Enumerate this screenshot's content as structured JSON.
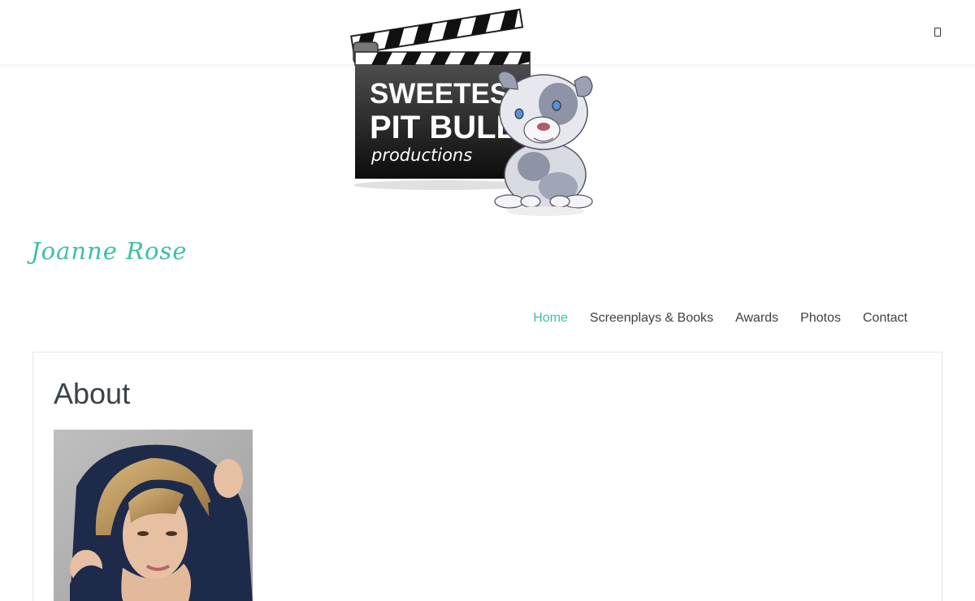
{
  "header": {
    "menu_icon": "menu-toggle-icon",
    "logo": {
      "line1": "SWEETEST",
      "line2": "PIT BULL",
      "line3": "productions"
    }
  },
  "site": {
    "title": "Joanne Rose",
    "accent_color": "#3cc0a4",
    "text_color": "#3b4248"
  },
  "nav": {
    "items": [
      {
        "label": "Home"
      },
      {
        "label": "Screenplays & Books"
      },
      {
        "label": "Awards"
      },
      {
        "label": "Photos"
      },
      {
        "label": "Contact"
      }
    ]
  },
  "main": {
    "heading": "About"
  }
}
